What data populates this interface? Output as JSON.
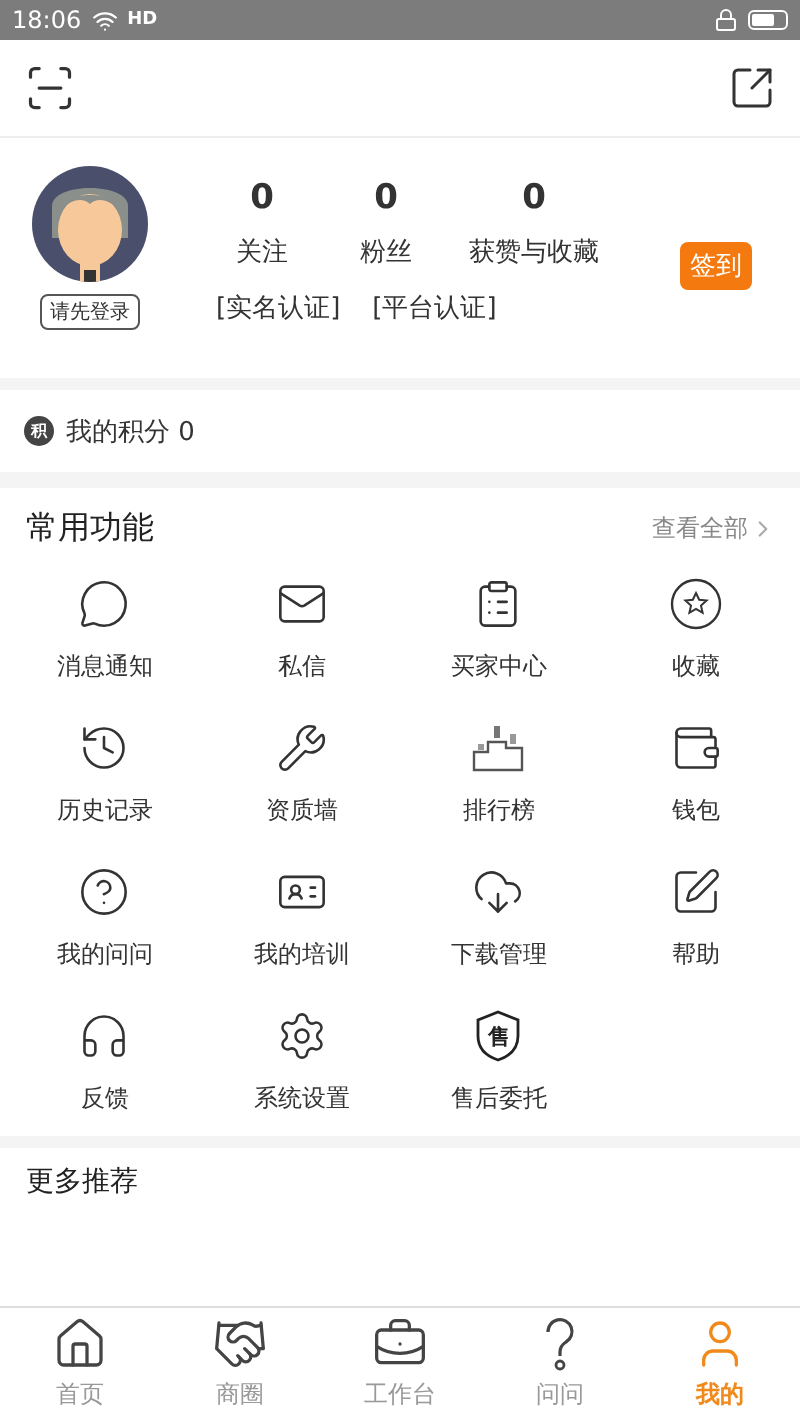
{
  "status_bar": {
    "time": "18:06",
    "network": "HD"
  },
  "profile": {
    "login_button": "请先登录",
    "stats": [
      {
        "value": "0",
        "label": "关注"
      },
      {
        "value": "0",
        "label": "粉丝"
      },
      {
        "value": "0",
        "label": "获赞与收藏"
      }
    ],
    "certifications": [
      "[实名认证]",
      "[平台认证]"
    ],
    "checkin_button": "签到"
  },
  "points": {
    "badge": "积",
    "label": "我的积分 0"
  },
  "functions": {
    "title": "常用功能",
    "view_all": "查看全部",
    "items": [
      {
        "kind": "message",
        "label": "消息通知"
      },
      {
        "kind": "mail",
        "label": "私信"
      },
      {
        "kind": "clipboard",
        "label": "买家中心"
      },
      {
        "kind": "star",
        "label": "收藏"
      },
      {
        "kind": "history",
        "label": "历史记录"
      },
      {
        "kind": "tools",
        "label": "资质墙"
      },
      {
        "kind": "podium",
        "label": "排行榜"
      },
      {
        "kind": "wallet",
        "label": "钱包"
      },
      {
        "kind": "question",
        "label": "我的问问"
      },
      {
        "kind": "idcard",
        "label": "我的培训"
      },
      {
        "kind": "download",
        "label": "下载管理"
      },
      {
        "kind": "edit",
        "label": "帮助"
      },
      {
        "kind": "headset",
        "label": "反馈"
      },
      {
        "kind": "gear",
        "label": "系统设置"
      },
      {
        "kind": "shield",
        "label": "售后委托",
        "glyph": "售"
      }
    ]
  },
  "more": {
    "title": "更多推荐"
  },
  "tabs": [
    {
      "kind": "home",
      "label": "首页",
      "selected": false
    },
    {
      "kind": "handshake",
      "label": "商圈",
      "selected": false
    },
    {
      "kind": "briefcase",
      "label": "工作台",
      "selected": false
    },
    {
      "kind": "ask",
      "label": "问问",
      "selected": false
    },
    {
      "kind": "user",
      "label": "我的",
      "selected": true
    }
  ]
}
